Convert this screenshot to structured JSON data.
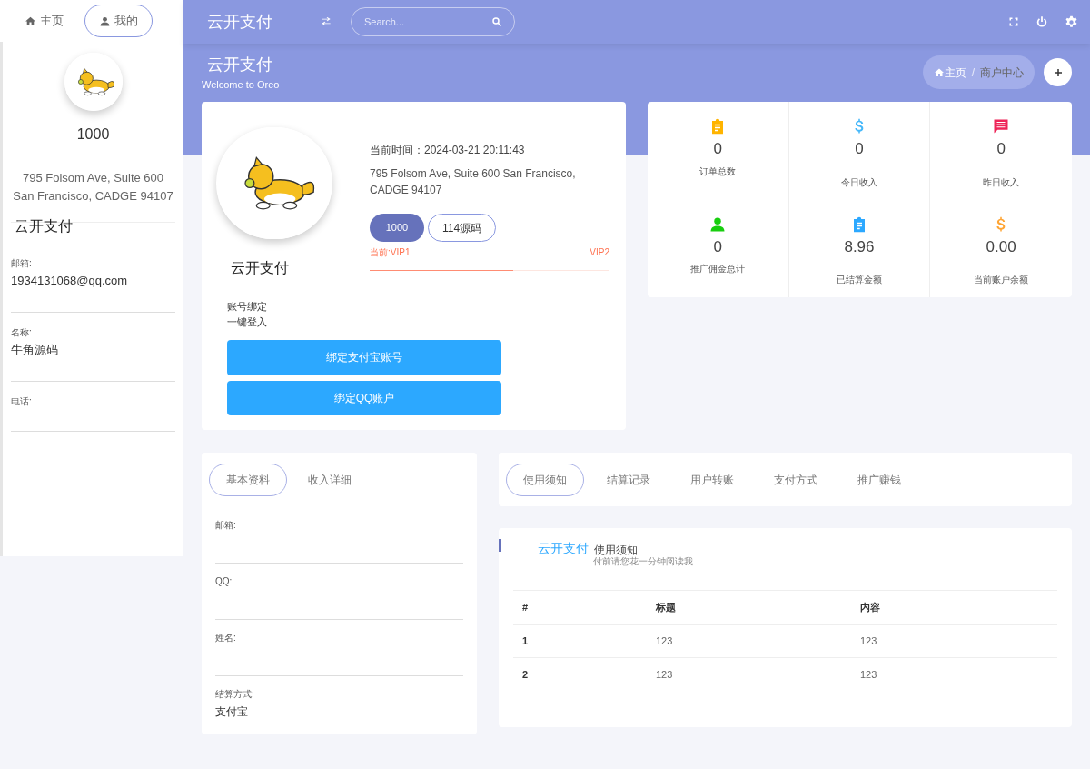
{
  "sidebar": {
    "tabs": [
      {
        "label": "主页",
        "selected": false
      },
      {
        "label": "我的",
        "selected": true
      }
    ],
    "profile": {
      "avatar": {
        "kind": "picture"
      },
      "count": "1000",
      "address_lines": [
        "795 Folsom Ave, Suite 600",
        "San Francisco, CADGE 94107"
      ],
      "name": "云开支付"
    },
    "fields": [
      {
        "label": "邮箱:",
        "value": "1934131068@qq.com"
      },
      {
        "label": "名称:",
        "value": "牛角源码"
      },
      {
        "label": "电话:"
      }
    ]
  },
  "topbar": {
    "brand": "云开支付",
    "search": {
      "placeholder": "Search..."
    }
  },
  "header": {
    "title": "云开支付",
    "subtitle": "Welcome to Oreo",
    "breadcrumb": [
      "主页",
      "商户中心"
    ],
    "breadcrumb_separator": "/"
  },
  "profile_card": {
    "avatar": {
      "kind": "picture"
    },
    "name": "云开支付",
    "time": "当前时间：2024-03-21 20:11:43",
    "address": "795 Folsom Ave, Suite 600 San Francisco, CADGE 94107",
    "badges": [
      {
        "label": "1000",
        "selected": true
      },
      {
        "label": "114源码",
        "selected": false
      }
    ],
    "vip": {
      "current": "当前:VIP1",
      "next": "VIP2",
      "level": 0.6
    },
    "binding_lines": [
      "账号绑定",
      "一键登入"
    ],
    "buttons": [
      "绑定支付宝账号",
      "绑定QQ账户"
    ]
  },
  "stats": [
    {
      "color": "#ffb400",
      "value": "0",
      "label": "订单总数"
    },
    {
      "color": "#46b8fa",
      "value": "0",
      "label": "今日收入"
    },
    {
      "color": "#ee2558",
      "value": "0",
      "label": "昨日收入"
    },
    {
      "color": "#18ce0f",
      "value": "0",
      "label": "推广佣金总计"
    },
    {
      "color": "#2ca8ff",
      "value": "8.96",
      "label": "已结算金额"
    },
    {
      "color": "#ffa534",
      "value": "0.00",
      "label": "当前账户余额"
    }
  ],
  "info_card": {
    "tabs": [
      {
        "label": "基本资料",
        "selected": true
      },
      {
        "label": "收入详细",
        "selected": false
      }
    ],
    "fields": [
      {
        "label": "邮箱:"
      },
      {
        "label": "QQ:"
      },
      {
        "label": "姓名:"
      },
      {
        "label": "结算方式:",
        "value": "支付宝"
      }
    ]
  },
  "notice_tabs": [
    {
      "label": "使用须知",
      "selected": true
    },
    {
      "label": "结算记录",
      "selected": false
    },
    {
      "label": "用户转账",
      "selected": false
    },
    {
      "label": "支付方式",
      "selected": false
    },
    {
      "label": "推广赚钱",
      "selected": false
    }
  ],
  "notice": {
    "overlay": "云开支付",
    "title": "使用须知",
    "subtitle": "付前请您花一分钟阅读我",
    "table": {
      "columns": [
        "#",
        "标题",
        "内容"
      ],
      "rows": [
        [
          "1",
          "123",
          "123"
        ],
        [
          "2",
          "123",
          "123"
        ]
      ]
    }
  }
}
